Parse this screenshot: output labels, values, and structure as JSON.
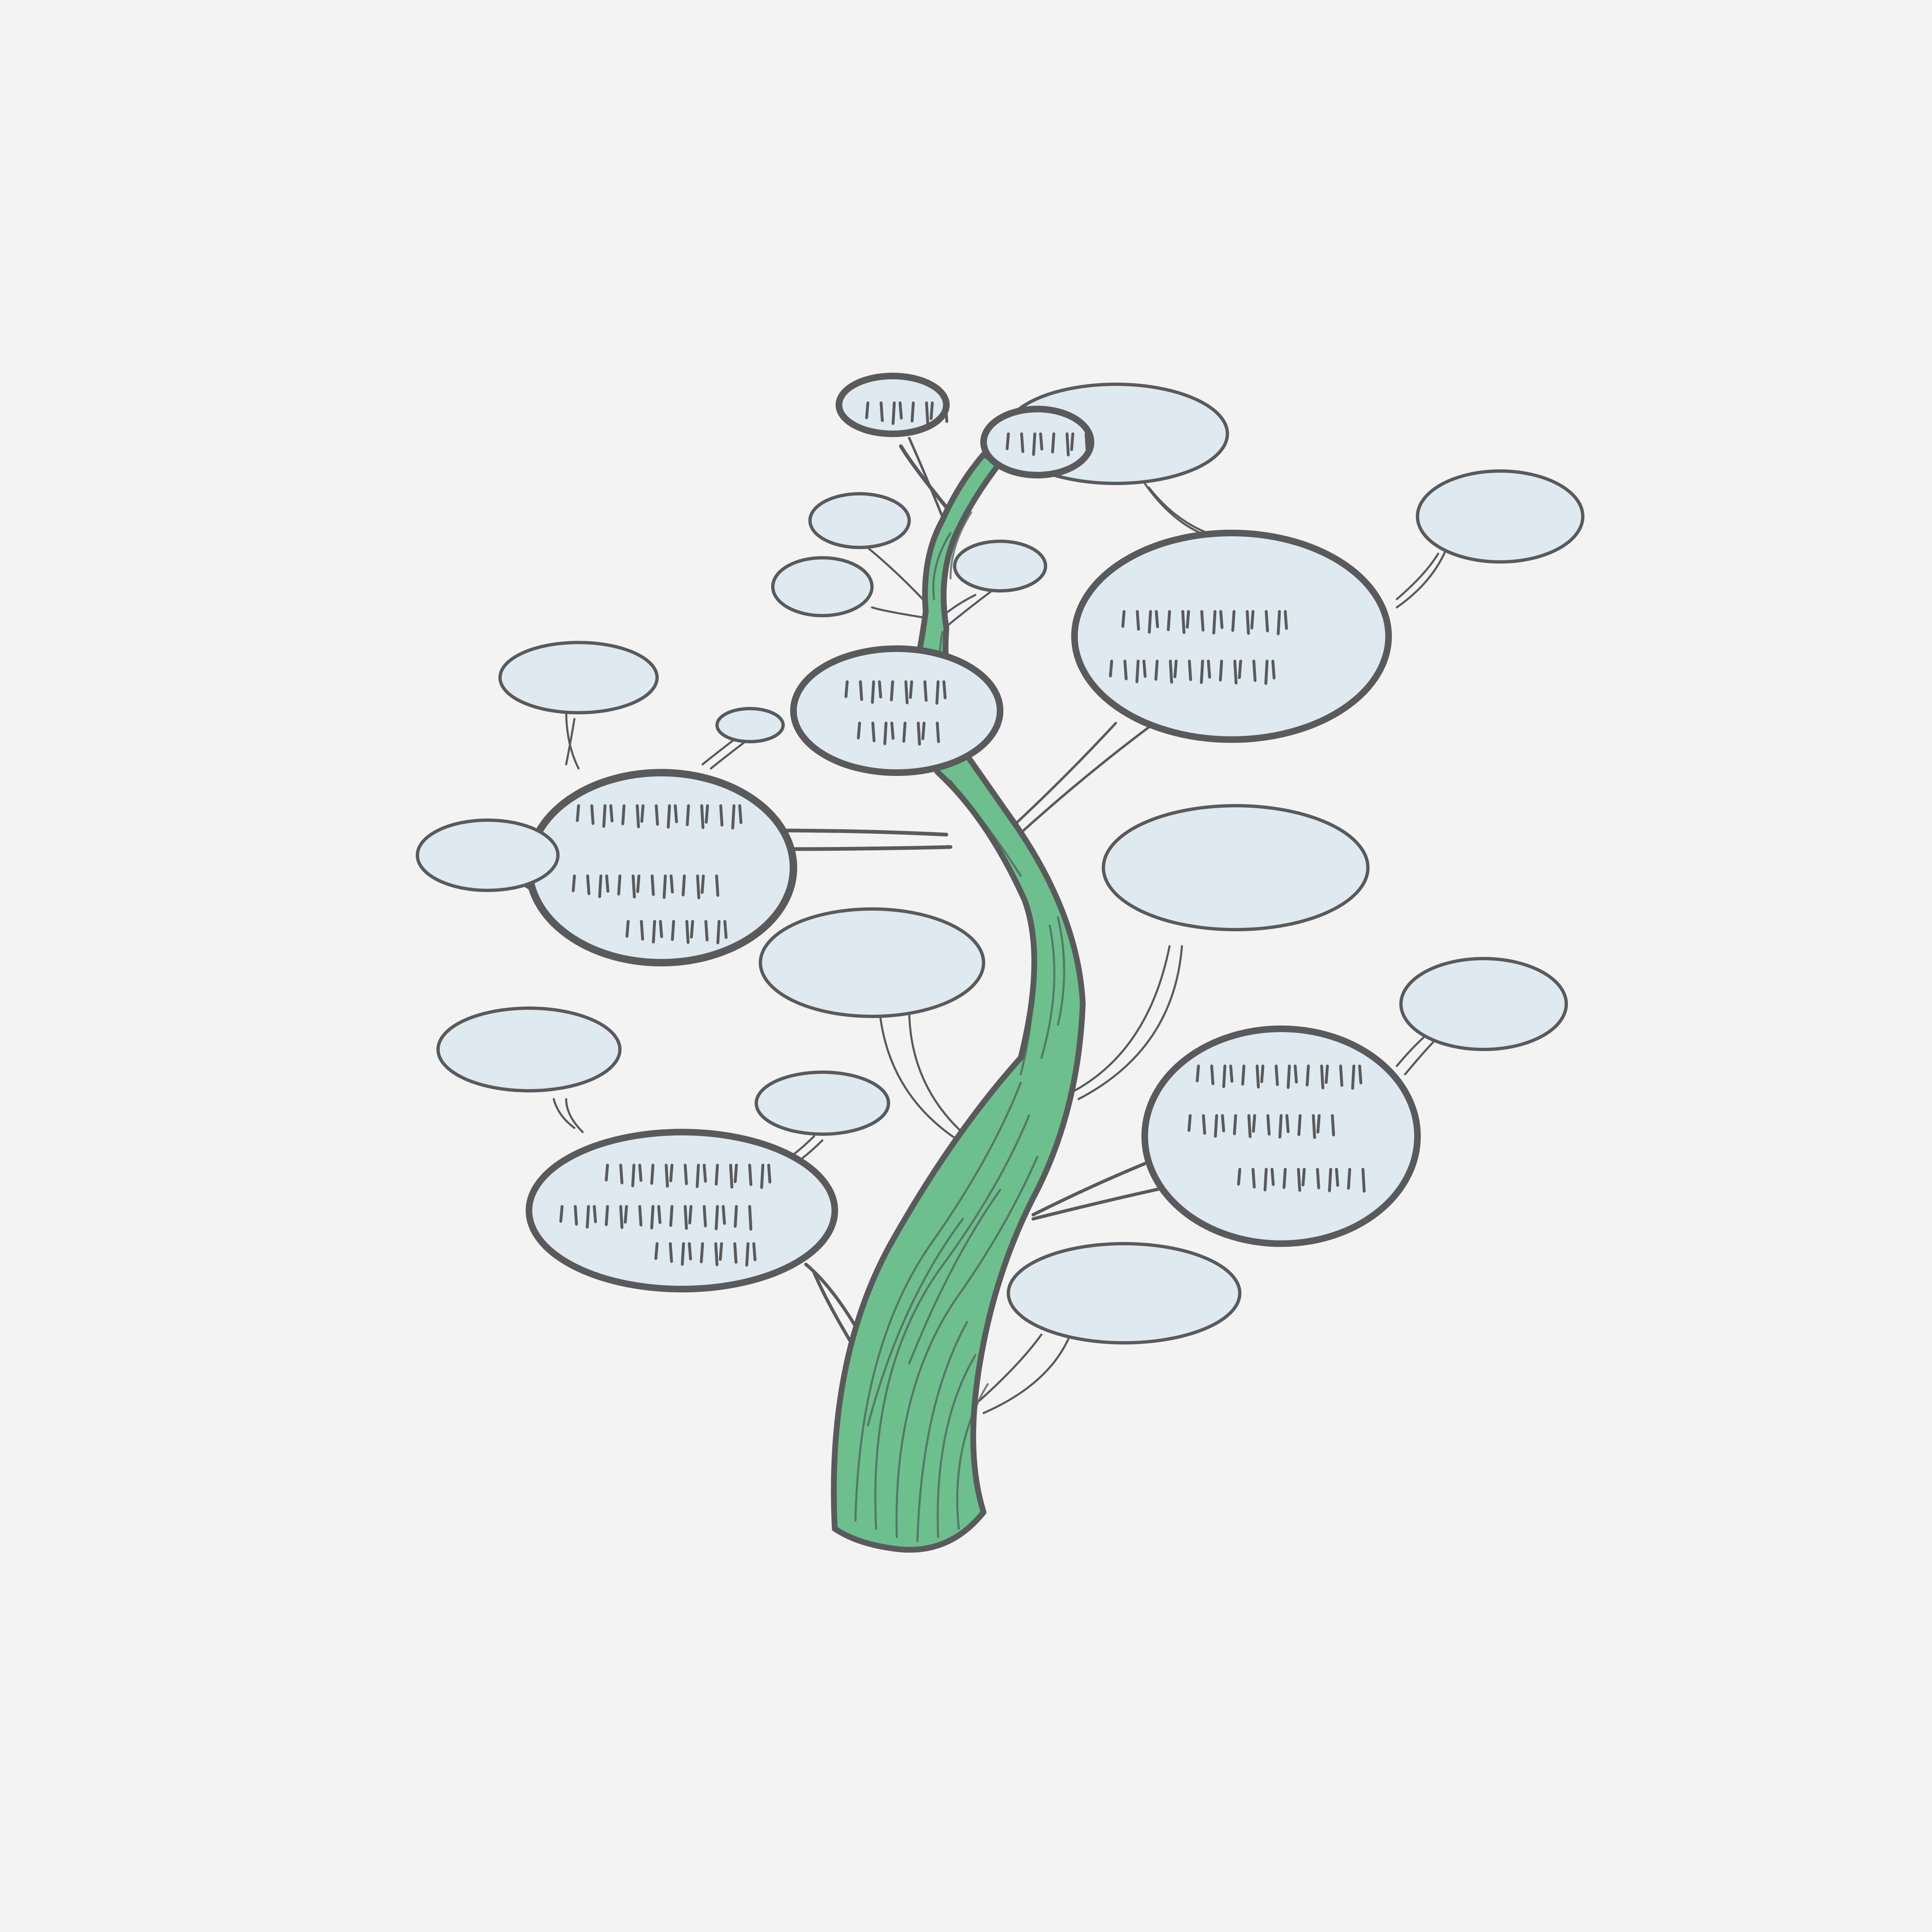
{
  "colors": {
    "background": "#f3f3f3",
    "bubble_fill": "#deeaf0",
    "trunk_fill": "#6dbf8e",
    "outline": "#5a5a5c"
  },
  "illustration": {
    "subject": "tree-with-speech-bubbles",
    "bubble_count": 20,
    "icon": "tree-icon"
  }
}
